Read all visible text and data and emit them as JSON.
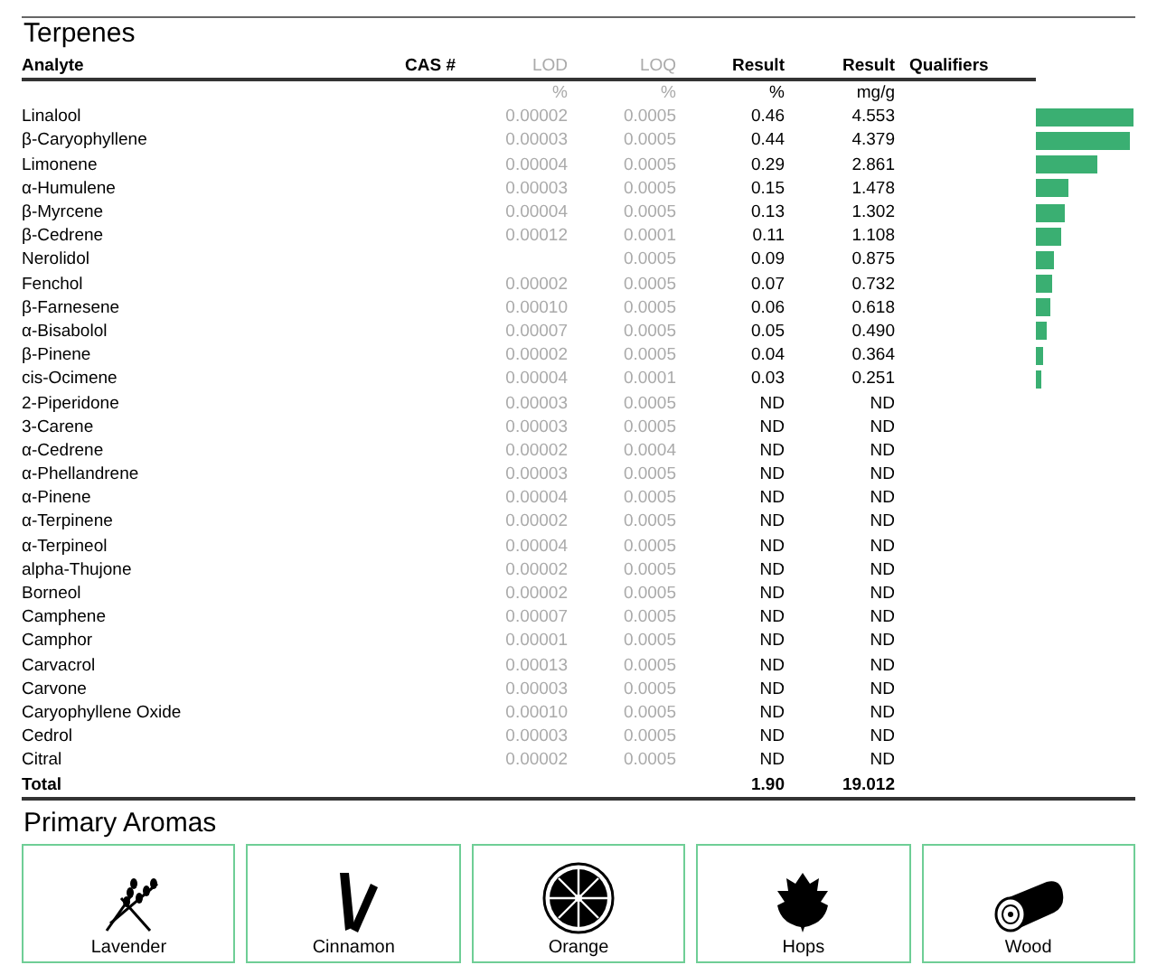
{
  "section_title": "Terpenes",
  "columns": [
    {
      "label": "Analyte"
    },
    {
      "label": "CAS #"
    },
    {
      "label": "LOD",
      "unit": "%"
    },
    {
      "label": "LOQ",
      "unit": "%"
    },
    {
      "label": "Result",
      "unit": "%"
    },
    {
      "label": "Result",
      "unit": "mg/g"
    },
    {
      "label": "Qualifiers"
    }
  ],
  "rows": [
    {
      "analyte": "Linalool",
      "lod": "0.00002",
      "loq": "0.0005",
      "pct": "0.46",
      "mgg": "4.553",
      "level": 1.0
    },
    {
      "analyte": "β-Caryophyllene",
      "lod": "0.00003",
      "loq": "0.0005",
      "pct": "0.44",
      "mgg": "4.379",
      "level": 0.96
    },
    {
      "analyte": "Limonene",
      "lod": "0.00004",
      "loq": "0.0005",
      "pct": "0.29",
      "mgg": "2.861",
      "level": 0.63
    },
    {
      "analyte": "α-Humulene",
      "lod": "0.00003",
      "loq": "0.0005",
      "pct": "0.15",
      "mgg": "1.478",
      "level": 0.33
    },
    {
      "analyte": "β-Myrcene",
      "lod": "0.00004",
      "loq": "0.0005",
      "pct": "0.13",
      "mgg": "1.302",
      "level": 0.29
    },
    {
      "analyte": "β-Cedrene",
      "lod": "0.00012",
      "loq": "0.0001",
      "pct": "0.11",
      "mgg": "1.108",
      "level": 0.25
    },
    {
      "analyte": "Nerolidol",
      "loq": "0.0005",
      "pct": "0.09",
      "mgg": "0.875",
      "level": 0.19
    },
    {
      "analyte": "Fenchol",
      "lod": "0.00002",
      "loq": "0.0005",
      "pct": "0.07",
      "mgg": "0.732",
      "level": 0.16
    },
    {
      "analyte": "β-Farnesene",
      "lod": "0.00010",
      "loq": "0.0005",
      "pct": "0.06",
      "mgg": "0.618",
      "level": 0.14
    },
    {
      "analyte": "α-Bisabolol",
      "lod": "0.00007",
      "loq": "0.0005",
      "pct": "0.05",
      "mgg": "0.490",
      "level": 0.11
    },
    {
      "analyte": "β-Pinene",
      "lod": "0.00002",
      "loq": "0.0005",
      "pct": "0.04",
      "mgg": "0.364",
      "level": 0.08
    },
    {
      "analyte": "cis-Ocimene",
      "lod": "0.00004",
      "loq": "0.0001",
      "pct": "0.03",
      "mgg": "0.251",
      "level": 0.06
    },
    {
      "analyte": "2-Piperidone",
      "lod": "0.00003",
      "loq": "0.0005",
      "pct": "ND",
      "mgg": "ND"
    },
    {
      "analyte": "3-Carene",
      "lod": "0.00003",
      "loq": "0.0005",
      "pct": "ND",
      "mgg": "ND"
    },
    {
      "analyte": "α-Cedrene",
      "lod": "0.00002",
      "loq": "0.0004",
      "pct": "ND",
      "mgg": "ND"
    },
    {
      "analyte": "α-Phellandrene",
      "lod": "0.00003",
      "loq": "0.0005",
      "pct": "ND",
      "mgg": "ND"
    },
    {
      "analyte": "α-Pinene",
      "lod": "0.00004",
      "loq": "0.0005",
      "pct": "ND",
      "mgg": "ND"
    },
    {
      "analyte": "α-Terpinene",
      "lod": "0.00002",
      "loq": "0.0005",
      "pct": "ND",
      "mgg": "ND"
    },
    {
      "analyte": "α-Terpineol",
      "lod": "0.00004",
      "loq": "0.0005",
      "pct": "ND",
      "mgg": "ND"
    },
    {
      "analyte": "alpha-Thujone",
      "lod": "0.00002",
      "loq": "0.0005",
      "pct": "ND",
      "mgg": "ND"
    },
    {
      "analyte": "Borneol",
      "lod": "0.00002",
      "loq": "0.0005",
      "pct": "ND",
      "mgg": "ND"
    },
    {
      "analyte": "Camphene",
      "lod": "0.00007",
      "loq": "0.0005",
      "pct": "ND",
      "mgg": "ND"
    },
    {
      "analyte": "Camphor",
      "lod": "0.00001",
      "loq": "0.0005",
      "pct": "ND",
      "mgg": "ND"
    },
    {
      "analyte": "Carvacrol",
      "lod": "0.00013",
      "loq": "0.0005",
      "pct": "ND",
      "mgg": "ND"
    },
    {
      "analyte": "Carvone",
      "lod": "0.00003",
      "loq": "0.0005",
      "pct": "ND",
      "mgg": "ND"
    },
    {
      "analyte": "Caryophyllene Oxide",
      "lod": "0.00010",
      "loq": "0.0005",
      "pct": "ND",
      "mgg": "ND"
    },
    {
      "analyte": "Cedrol",
      "lod": "0.00003",
      "loq": "0.0005",
      "pct": "ND",
      "mgg": "ND"
    },
    {
      "analyte": "Citral",
      "lod": "0.00002",
      "loq": "0.0005",
      "pct": "ND",
      "mgg": "ND"
    }
  ],
  "total": {
    "label": "Total",
    "pct": "1.90",
    "mgg": "19.012"
  },
  "aromas_title": "Primary Aromas",
  "aromas": [
    {
      "label": "Lavender",
      "kind": "lavender"
    },
    {
      "label": "Cinnamon",
      "kind": "cinnamon"
    },
    {
      "label": "Orange",
      "kind": "orange"
    },
    {
      "label": "Hops",
      "kind": "hops"
    },
    {
      "label": "Wood",
      "kind": "wood"
    }
  ]
}
